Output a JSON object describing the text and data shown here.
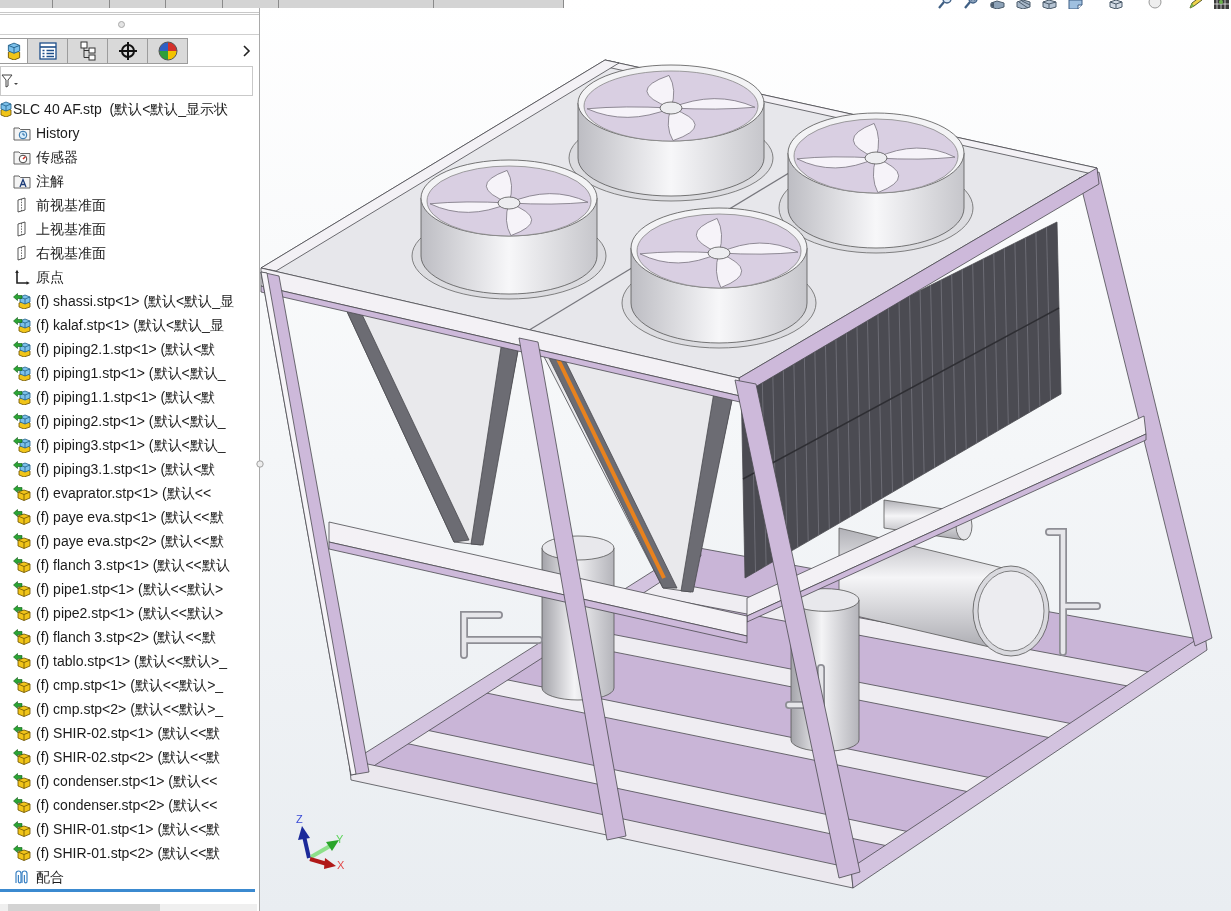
{
  "panel_tabs": [
    {
      "kind": "tree",
      "selected": true
    },
    {
      "kind": "properties",
      "selected": false
    },
    {
      "kind": "configurations",
      "selected": false
    },
    {
      "kind": "target",
      "selected": false
    },
    {
      "kind": "appearance",
      "selected": false
    }
  ],
  "tree": {
    "label": "SLC 40 AF.stp  (默认<默认_显示状",
    "kind": "assembly",
    "children": [
      {
        "label": "History",
        "kind": "history"
      },
      {
        "label": "传感器",
        "kind": "sensors"
      },
      {
        "label": "注解",
        "kind": "annotations"
      },
      {
        "label": "前视基准面",
        "kind": "plane"
      },
      {
        "label": "上视基准面",
        "kind": "plane"
      },
      {
        "label": "右视基准面",
        "kind": "plane"
      },
      {
        "label": "原点",
        "kind": "origin"
      },
      {
        "label": "(f) shassi.stp<1> (默认<默认_显",
        "kind": "subassembly"
      },
      {
        "label": "(f) kalaf.stp<1> (默认<默认_显",
        "kind": "subassembly"
      },
      {
        "label": "(f) piping2.1.stp<1> (默认<默",
        "kind": "subassembly"
      },
      {
        "label": "(f) piping1.stp<1> (默认<默认_",
        "kind": "subassembly"
      },
      {
        "label": "(f) piping1.1.stp<1> (默认<默",
        "kind": "subassembly"
      },
      {
        "label": "(f) piping2.stp<1> (默认<默认_",
        "kind": "subassembly"
      },
      {
        "label": "(f) piping3.stp<1> (默认<默认_",
        "kind": "subassembly"
      },
      {
        "label": "(f) piping3.1.stp<1> (默认<默",
        "kind": "subassembly"
      },
      {
        "label": "(f) evaprator.stp<1> (默认<<",
        "kind": "part"
      },
      {
        "label": "(f) paye eva.stp<1> (默认<<默",
        "kind": "part"
      },
      {
        "label": "(f) paye eva.stp<2> (默认<<默",
        "kind": "part"
      },
      {
        "label": "(f) flanch 3.stp<1> (默认<<默认",
        "kind": "part"
      },
      {
        "label": "(f) pipe1.stp<1> (默认<<默认>",
        "kind": "part"
      },
      {
        "label": "(f) pipe2.stp<1> (默认<<默认>",
        "kind": "part"
      },
      {
        "label": "(f) flanch 3.stp<2> (默认<<默",
        "kind": "part"
      },
      {
        "label": "(f) tablo.stp<1> (默认<<默认>_",
        "kind": "part"
      },
      {
        "label": "(f) cmp.stp<1> (默认<<默认>_",
        "kind": "part"
      },
      {
        "label": "(f) cmp.stp<2> (默认<<默认>_",
        "kind": "part"
      },
      {
        "label": "(f) SHIR-02.stp<1> (默认<<默",
        "kind": "part"
      },
      {
        "label": "(f) SHIR-02.stp<2> (默认<<默",
        "kind": "part"
      },
      {
        "label": "(f) condenser.stp<1> (默认<<",
        "kind": "part"
      },
      {
        "label": "(f) condenser.stp<2> (默认<<",
        "kind": "part"
      },
      {
        "label": "(f) SHIR-01.stp<1> (默认<<默",
        "kind": "part"
      },
      {
        "label": "(f) SHIR-01.stp<2> (默认<<默",
        "kind": "part"
      },
      {
        "label": "配合",
        "kind": "mates"
      }
    ]
  },
  "triad": {
    "z": "Z",
    "y": "Y",
    "x": "X"
  }
}
